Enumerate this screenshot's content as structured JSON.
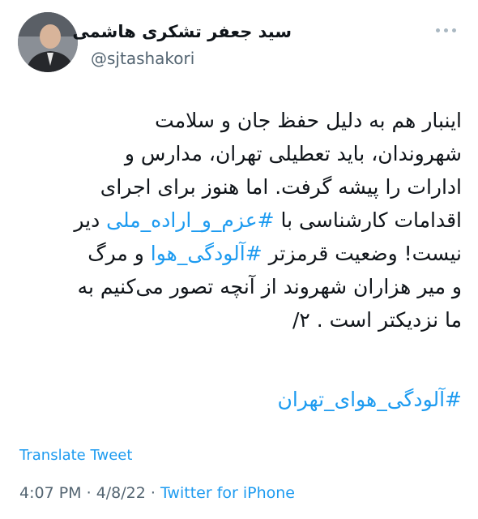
{
  "author": {
    "name": "سید جعفر تشکری هاشمی",
    "handle": "@sjtashakori"
  },
  "tweet": {
    "line1": "اینبار هم به دلیل حفظ جان و سلامت",
    "line2": "شهروندان، باید تعطیلی تهران، مدارس و",
    "line3": "ادارات را پیشه گرفت. اما هنوز برای اجرای",
    "line4_pre": "اقدامات کارشناسی با ",
    "line4_tag": "#عزم_و_اراده_ملی",
    "line4_post": " دیر",
    "line5_pre": "نیست! وضعیت قرمزتر ",
    "line5_tag": "#آلودگی_هوا",
    "line5_post": " و مرگ",
    "line6": "و میر  هزاران شهروند از آنچه تصور می‌کنیم به",
    "line7": "ما نزدیکتر است . ۲/",
    "trailing_hashtag": "#آلودگی_هوای_تهران"
  },
  "translate_label": "Translate Tweet",
  "meta": {
    "time": "4:07 PM",
    "separator1": " · ",
    "date": "4/8/22",
    "separator2": " · ",
    "source": "Twitter for iPhone"
  },
  "icons": {
    "more": "more-dots-icon"
  }
}
